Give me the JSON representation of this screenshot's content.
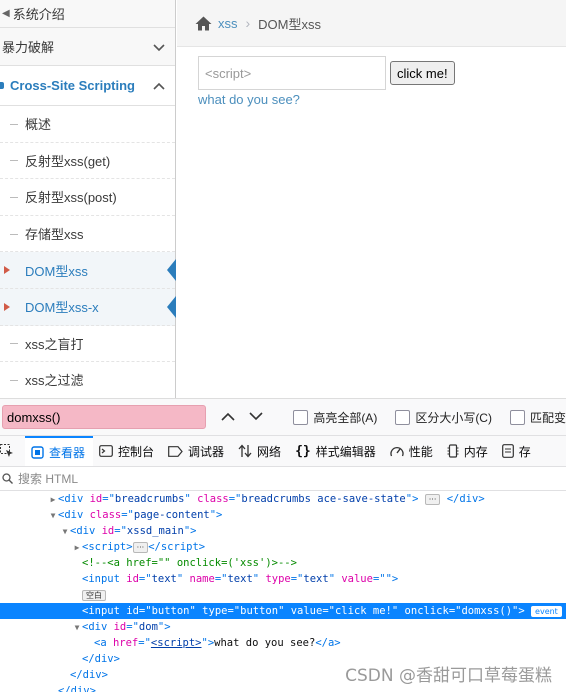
{
  "sidebar": {
    "top_item": "系统介绍",
    "menu_item": "暴力破解",
    "active_section": "Cross-Site Scripting",
    "sub_items": [
      {
        "label": "概述",
        "active": false
      },
      {
        "label": "反射型xss(get)",
        "active": false
      },
      {
        "label": "反射型xss(post)",
        "active": false
      },
      {
        "label": "存储型xss",
        "active": false
      },
      {
        "label": "DOM型xss",
        "active": true
      },
      {
        "label": "DOM型xss-x",
        "active": true
      },
      {
        "label": "xss之盲打",
        "active": false
      },
      {
        "label": "xss之过滤",
        "active": false
      }
    ]
  },
  "breadcrumbs": {
    "link": "xss",
    "current": "DOM型xss"
  },
  "form": {
    "input_value": "<script>",
    "button_label": "click me!",
    "result_link": "what do you see?"
  },
  "findbar": {
    "query": "domxss()",
    "options": [
      "高亮全部(A)",
      "区分大小写(C)",
      "匹配变"
    ]
  },
  "devtools": {
    "tabs": [
      "查看器",
      "控制台",
      "调试器",
      "网络",
      "样式编辑器",
      "性能",
      "内存",
      "存"
    ],
    "selected_tab": "查看器",
    "search_placeholder": "搜索 HTML"
  },
  "markup": {
    "l1_id": "breadcrumbs",
    "l1_class": "breadcrumbs ace-save-state",
    "l2_class": "page-content",
    "l3_id": "xssd_main",
    "l5_comment": "<!--<a href=\"\" onclick=('xss')>-->",
    "l6_id": "text",
    "l6_name": "text",
    "l6_type": "text",
    "l6_value": "",
    "l7_badge": "空白",
    "l8_id": "button",
    "l8_type": "button",
    "l8_value": "click me!",
    "l8_onclick": "domxss()",
    "l8_badge": "event",
    "l9_id": "dom",
    "l10_href": "<script>",
    "l10_text": "what do you see?",
    "ellipsis": "···"
  },
  "watermark": "CSDN @香甜可口草莓蛋糕",
  "colors": {
    "link_blue": "#4c8fbd",
    "active_blue": "#2b7dbc",
    "selection_blue": "#0a84ff",
    "find_highlight": "#f5b8c6"
  }
}
